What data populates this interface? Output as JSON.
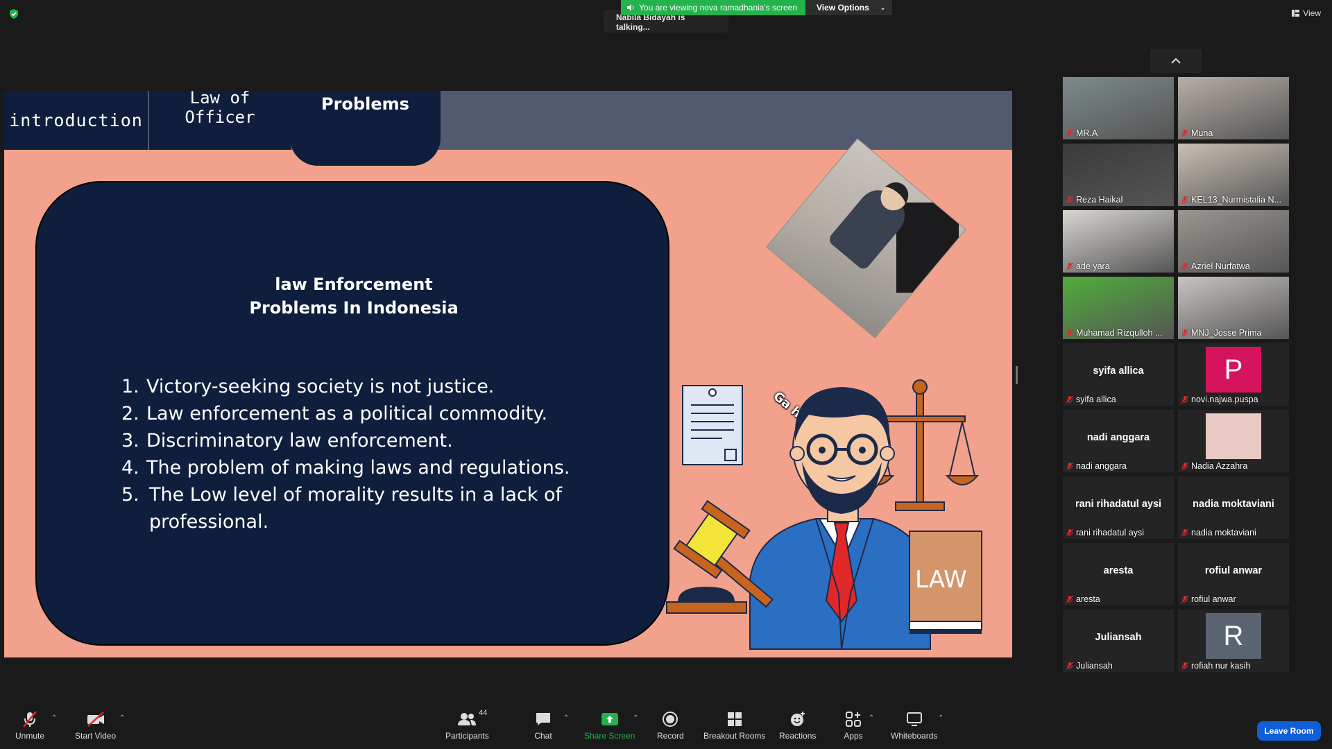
{
  "top": {
    "banner_text": "You are viewing nova ramadhania's screen",
    "view_options_label": "View Options",
    "talking_text": "Nabila Bidayah is talking...",
    "view_label": "View"
  },
  "slide": {
    "tabs": {
      "introduction": "introduction",
      "law_line1": "Law of",
      "law_line2": "Officer",
      "problems": "Problems"
    },
    "title_line1": "law Enforcement",
    "title_line2": "Problems In Indonesia",
    "items": [
      {
        "num": "1.",
        "text": "Victory-seeking society is not justice."
      },
      {
        "num": "2.",
        "text": "Law enforcement as a political commodity."
      },
      {
        "num": "3.",
        "text": "Discriminatory law enforcement."
      },
      {
        "num": "4.",
        "text": "The problem of making laws and regulations."
      },
      {
        "num": "5.",
        "text": "The Low level of morality results in a lack of professional."
      }
    ],
    "photo_caption": "Ga habis thinking",
    "book_label": "LAW"
  },
  "participants": [
    {
      "name": "MR.A",
      "video": true,
      "bg": "#7d8a8c"
    },
    {
      "name": "Muna",
      "video": true,
      "bg": "#b7aea6"
    },
    {
      "name": "Reza Haikal",
      "video": true,
      "bg": "#3a3a3a"
    },
    {
      "name": "KEL13_Nurmistalia N...",
      "video": true,
      "bg": "#c9c0b4"
    },
    {
      "name": "ade yara",
      "video": true,
      "bg": "#d9d6d2"
    },
    {
      "name": "Azriel Nurfatwa",
      "video": true,
      "bg": "#9a9690"
    },
    {
      "name": "Muhamad Rizqulloh ...",
      "video": true,
      "bg": "#4fae3a"
    },
    {
      "name": "MNJ_Josse Prima",
      "video": true,
      "bg": "#c8c4c0"
    },
    {
      "name": "syifa allica",
      "video": false,
      "big": "syifa allica"
    },
    {
      "name": "novi.najwa.puspa",
      "video": false,
      "avatar": "P",
      "avatar_bg": "#d6145e"
    },
    {
      "name": "nadi anggara",
      "video": false,
      "big": "nadi anggara"
    },
    {
      "name": "Nadia Azzahra",
      "video": false,
      "avatar": "",
      "avatar_bg": "#e9c9c4"
    },
    {
      "name": "rani rihadatul aysi",
      "video": false,
      "big": "rani rihadatul aysi"
    },
    {
      "name": "nadia moktaviani",
      "video": false,
      "big": "nadia moktaviani"
    },
    {
      "name": "aresta",
      "video": false,
      "big": "aresta"
    },
    {
      "name": "rofiul anwar",
      "video": false,
      "big": "rofiul anwar"
    },
    {
      "name": "Juliansah",
      "video": false,
      "big": "Juliansah"
    },
    {
      "name": "rofiah nur kasih",
      "video": false,
      "avatar": "R",
      "avatar_bg": "#5a6470"
    }
  ],
  "toolbar": {
    "unmute": "Unmute",
    "start_video": "Start Video",
    "participants": "Participants",
    "participants_count": "44",
    "chat": "Chat",
    "share_screen": "Share Screen",
    "record": "Record",
    "breakout_rooms": "Breakout Rooms",
    "reactions": "Reactions",
    "apps": "Apps",
    "whiteboards": "Whiteboards",
    "leave_room": "Leave Room"
  },
  "colors": {
    "slide_bg": "#f2a28c",
    "navy": "#0f1e3c",
    "share_green": "#23b24b",
    "leave_blue": "#0e5fd8",
    "mic_muted_red": "#e02828"
  }
}
